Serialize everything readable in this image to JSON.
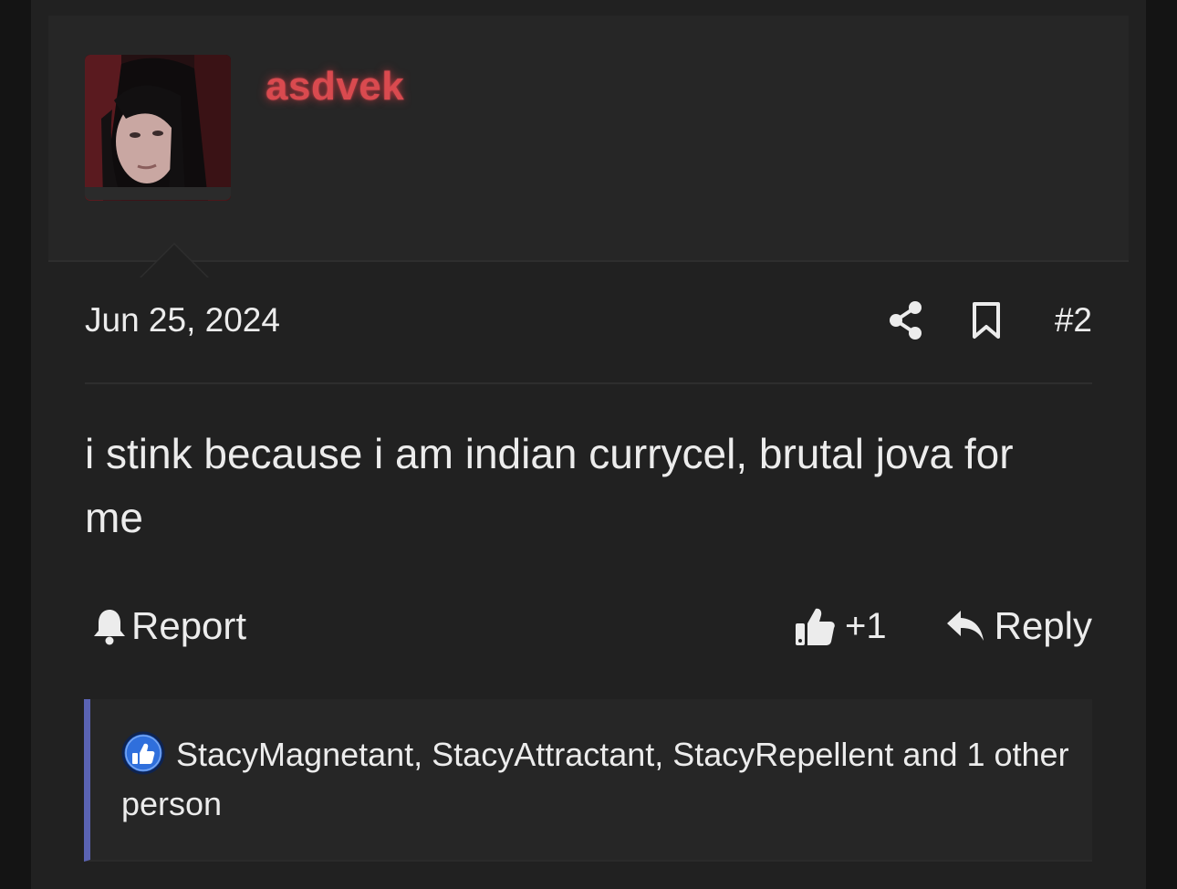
{
  "user": {
    "username": "asdvek"
  },
  "post": {
    "date": "Jun 25, 2024",
    "number": "#2",
    "body": "i stink because i am indian currycel, brutal jova for me"
  },
  "actions": {
    "report_label": "Report",
    "like_label": "+1",
    "reply_label": "Reply"
  },
  "reactions": {
    "text": "StacyMagnetant, StacyAttractant, StacyRepellent and 1 other person"
  },
  "colors": {
    "background": "#212121",
    "username": "#d94a4f",
    "reactions_accent": "#5a63b3",
    "like_badge": "#2f6fdc"
  }
}
